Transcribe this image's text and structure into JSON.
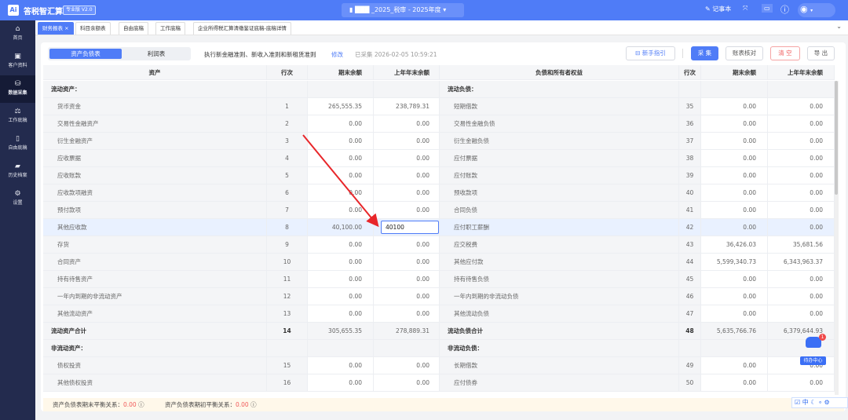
{
  "header": {
    "app_title": "答税智汇算",
    "edition": "专业版 V2.0",
    "project": "_2025_税审 - 2025年度",
    "notebook": "记事本",
    "logo": "Ai"
  },
  "sidebar": [
    {
      "label": "首页",
      "icon": "⌂"
    },
    {
      "label": "客户资料",
      "icon": "▣"
    },
    {
      "label": "数据采集",
      "icon": "⛁"
    },
    {
      "label": "工作底稿",
      "icon": "⚖"
    },
    {
      "label": "自由底稿",
      "icon": "▯"
    },
    {
      "label": "历史档案",
      "icon": "▰"
    },
    {
      "label": "设置",
      "icon": "⚙"
    }
  ],
  "tabs": [
    "财务报表 ×",
    "科目余额表",
    "自由底稿",
    "工作底稿",
    "企业所得税汇算清缴鉴证底稿-底稿详情"
  ],
  "toolbar": {
    "seg_on": "资产负债表",
    "seg_off": "利润表",
    "rule": "执行新金融准则、新收入准则和新租赁准则",
    "edit": "修改",
    "collected": "已采集",
    "time": "2026-02-05 10:59:21",
    "guide": "新手指引",
    "collect": "采 集",
    "check": "账表核对",
    "clear": "清 空",
    "export": "导 出"
  },
  "columns": {
    "asset": "资产",
    "no": "行次",
    "end": "期末余额",
    "prev": "上年年末余额",
    "liab": "负债和所有者权益",
    "no2": "行次",
    "end2": "期末余额",
    "prev2": "上年年末余额"
  },
  "rows": [
    {
      "t": "sec",
      "l": [
        "流动资产：",
        "",
        "",
        ""
      ],
      "r": [
        "流动负债：",
        "",
        "",
        ""
      ]
    },
    {
      "t": "sub",
      "l": [
        "货币资金",
        "1",
        "265,555.35",
        "238,789.31"
      ],
      "r": [
        "短期借款",
        "35",
        "0.00",
        "0.00"
      ]
    },
    {
      "t": "sub",
      "l": [
        "交易性金融资产",
        "2",
        "0.00",
        "0.00"
      ],
      "r": [
        "交易性金融负债",
        "36",
        "0.00",
        "0.00"
      ]
    },
    {
      "t": "sub",
      "l": [
        "衍生金融资产",
        "3",
        "0.00",
        "0.00"
      ],
      "r": [
        "衍生金融负债",
        "37",
        "0.00",
        "0.00"
      ]
    },
    {
      "t": "sub",
      "l": [
        "应收票据",
        "4",
        "0.00",
        "0.00"
      ],
      "r": [
        "应付票据",
        "38",
        "0.00",
        "0.00"
      ]
    },
    {
      "t": "sub",
      "l": [
        "应收账款",
        "5",
        "0.00",
        "0.00"
      ],
      "r": [
        "应付账款",
        "39",
        "0.00",
        "0.00"
      ]
    },
    {
      "t": "sub",
      "l": [
        "应收款项融资",
        "6",
        "0.00",
        "0.00"
      ],
      "r": [
        "预收款项",
        "40",
        "0.00",
        "0.00"
      ]
    },
    {
      "t": "sub",
      "l": [
        "预付款项",
        "7",
        "0.00",
        "0.00"
      ],
      "r": [
        "合同负债",
        "41",
        "0.00",
        "0.00"
      ]
    },
    {
      "t": "sub hl",
      "l": [
        "其他应收款",
        "8",
        "40,100.00",
        "40100"
      ],
      "r": [
        "应付职工薪酬",
        "42",
        "0.00",
        "0.00"
      ],
      "edit": true
    },
    {
      "t": "sub",
      "l": [
        "存货",
        "9",
        "0.00",
        "0.00"
      ],
      "r": [
        "应交税费",
        "43",
        "36,426.03",
        "35,681.56"
      ]
    },
    {
      "t": "sub",
      "l": [
        "合同资产",
        "10",
        "0.00",
        "0.00"
      ],
      "r": [
        "其他应付款",
        "44",
        "5,599,340.73",
        "6,343,963.37"
      ]
    },
    {
      "t": "sub",
      "l": [
        "持有待售资产",
        "11",
        "0.00",
        "0.00"
      ],
      "r": [
        "持有待售负债",
        "45",
        "0.00",
        "0.00"
      ]
    },
    {
      "t": "sub",
      "l": [
        "一年内到期的非流动资产",
        "12",
        "0.00",
        "0.00"
      ],
      "r": [
        "一年内到期的非流动负债",
        "46",
        "0.00",
        "0.00"
      ]
    },
    {
      "t": "sub",
      "l": [
        "其他流动资产",
        "13",
        "0.00",
        "0.00"
      ],
      "r": [
        "其他流动负债",
        "47",
        "0.00",
        "0.00"
      ]
    },
    {
      "t": "tot",
      "l": [
        "流动资产合计",
        "14",
        "305,655.35",
        "278,889.31"
      ],
      "r": [
        "流动负债合计",
        "48",
        "5,635,766.76",
        "6,379,644.93"
      ]
    },
    {
      "t": "sec",
      "l": [
        "非流动资产：",
        "",
        "",
        ""
      ],
      "r": [
        "非流动负债：",
        "",
        "",
        ""
      ]
    },
    {
      "t": "sub",
      "l": [
        "债权投资",
        "15",
        "0.00",
        "0.00"
      ],
      "r": [
        "长期借款",
        "49",
        "0.00",
        "0.00"
      ]
    },
    {
      "t": "sub",
      "l": [
        "其他债权投资",
        "16",
        "0.00",
        "0.00"
      ],
      "r": [
        "应付债券",
        "50",
        "0.00",
        "0.00"
      ]
    }
  ],
  "footer": {
    "end_label": "资产负债表期末平衡关系：",
    "end_val": "0.00",
    "begin_label": "资产负债表期初平衡关系：",
    "begin_val": "0.00"
  },
  "widget": {
    "label": "待办中心",
    "count": "1"
  },
  "ime": [
    "中"
  ]
}
